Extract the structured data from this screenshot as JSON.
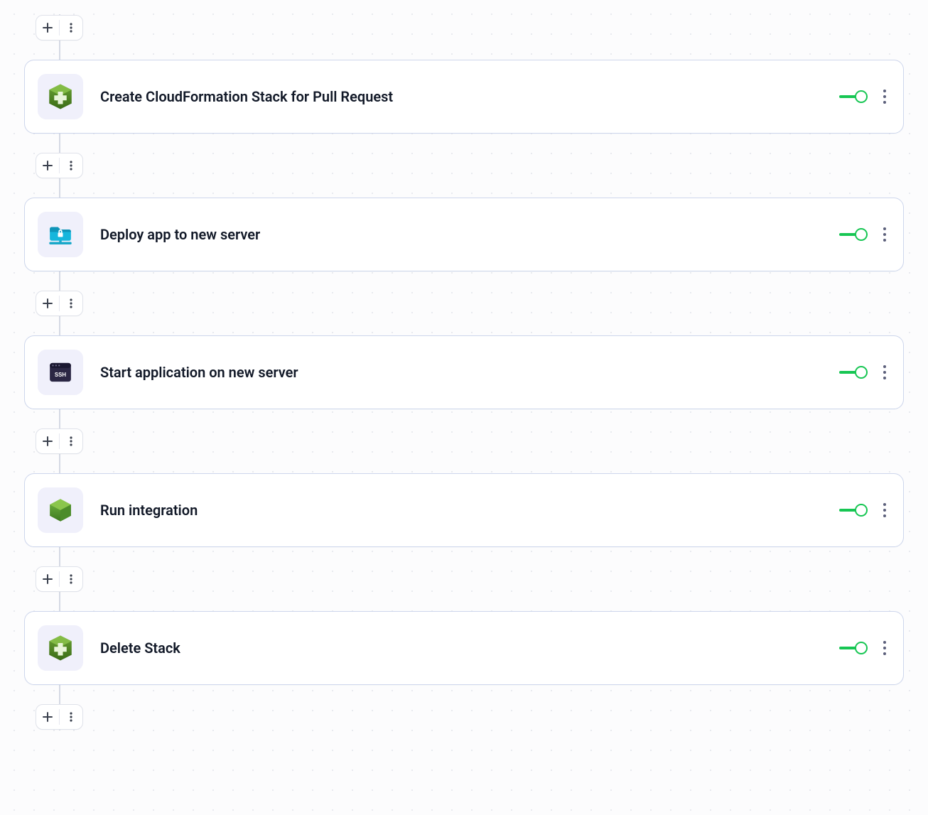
{
  "colors": {
    "toggle_on": "#17c653",
    "card_border": "#cdd6ec",
    "icon_bg": "#f0f0fb"
  },
  "steps": [
    {
      "label": "Create CloudFormation Stack for Pull Request",
      "icon": "cloudformation",
      "enabled": true
    },
    {
      "label": "Deploy app to new server",
      "icon": "sftp",
      "enabled": true
    },
    {
      "label": "Start application on new server",
      "icon": "ssh",
      "enabled": true
    },
    {
      "label": "Run integration",
      "icon": "node",
      "enabled": true
    },
    {
      "label": "Delete Stack",
      "icon": "cloudformation",
      "enabled": true
    }
  ]
}
